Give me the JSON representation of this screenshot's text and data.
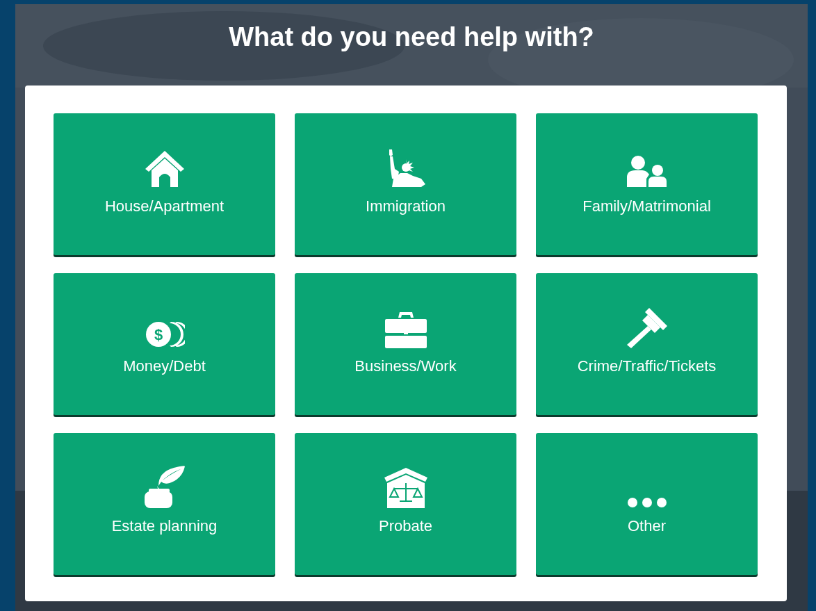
{
  "heading": "What do you need help with?",
  "categories": [
    {
      "label": "House/Apartment"
    },
    {
      "label": "Immigration"
    },
    {
      "label": "Family/Matrimonial"
    },
    {
      "label": "Money/Debt",
      "icon_symbol": "$"
    },
    {
      "label": "Business/Work"
    },
    {
      "label": "Crime/Traffic/Tickets"
    },
    {
      "label": "Estate planning"
    },
    {
      "label": "Probate"
    },
    {
      "label": "Other"
    }
  ]
}
